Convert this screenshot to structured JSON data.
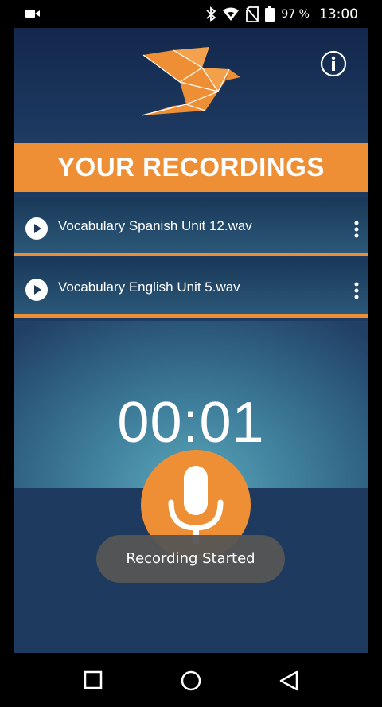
{
  "status_bar": {
    "battery_text": "97 %",
    "time": "13:00",
    "icons": [
      "video-camera-icon",
      "bluetooth-icon",
      "wifi-icon",
      "no-sim-icon",
      "battery-icon"
    ]
  },
  "header": {
    "logo_icon": "origami-bird-logo",
    "info_icon": "info-icon"
  },
  "banner": {
    "title": "YOUR RECORDINGS"
  },
  "recordings": [
    {
      "name": "Vocabulary Spanish Unit 12.wav"
    },
    {
      "name": "Vocabulary English Unit 5.wav"
    }
  ],
  "recorder": {
    "timer": "00:01",
    "mic_icon": "microphone-icon"
  },
  "toast": {
    "message": "Recording Started"
  },
  "nav_bar": {
    "icons": [
      "recents-square-icon",
      "home-circle-icon",
      "back-triangle-icon"
    ]
  },
  "colors": {
    "accent": "#ee8f35",
    "background": "#1f3a5f",
    "toast": "#555555"
  }
}
